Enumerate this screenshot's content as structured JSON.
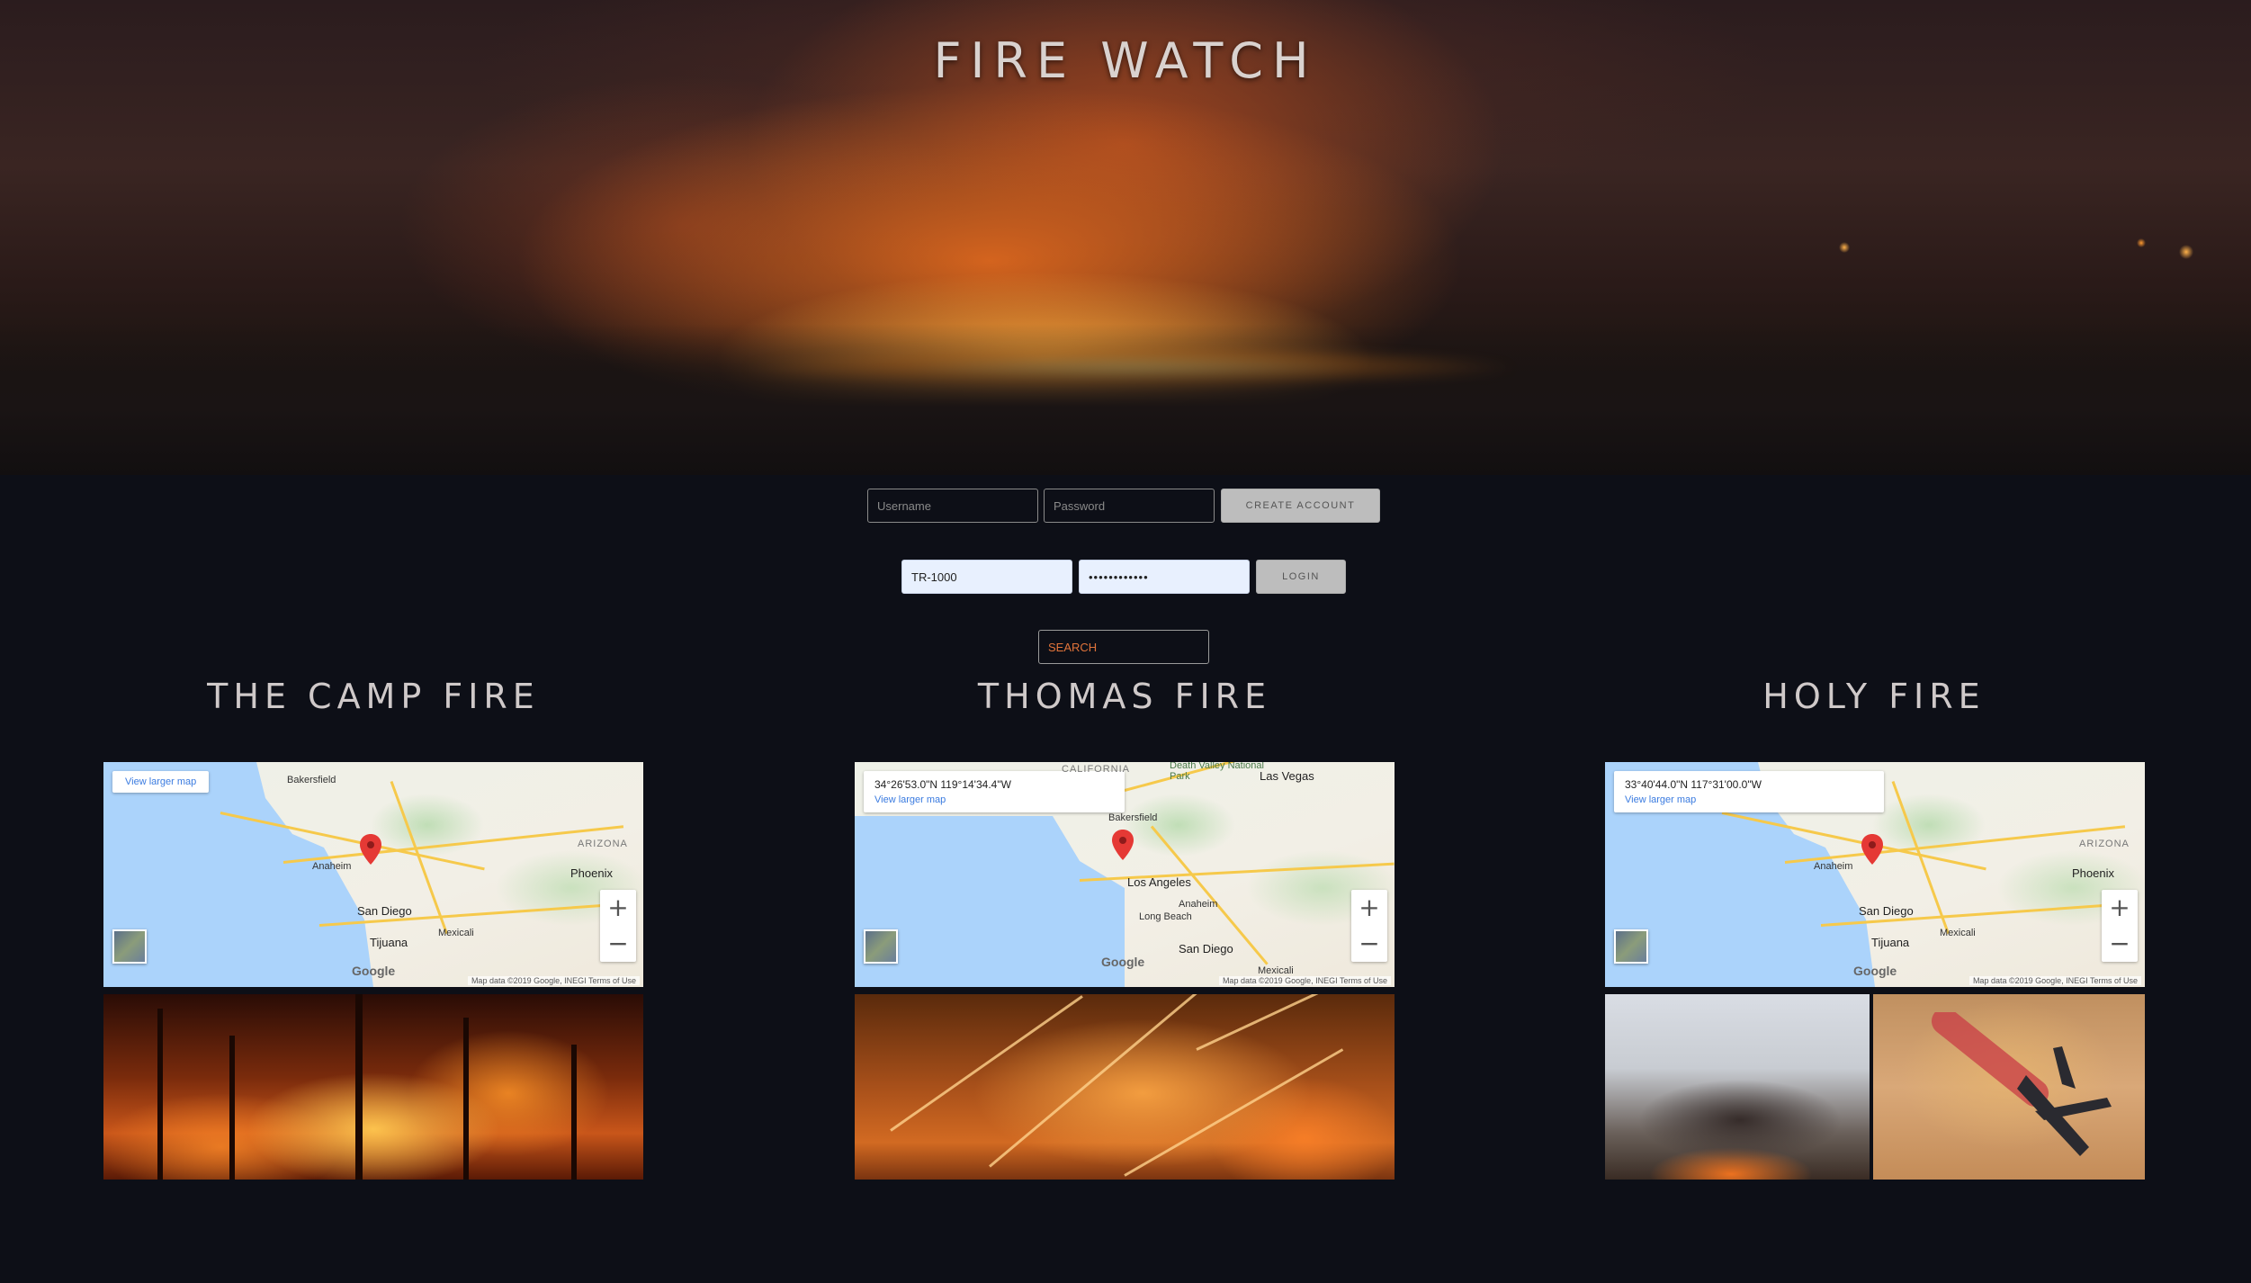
{
  "hero": {
    "title": "FIRE WATCH"
  },
  "create_account": {
    "username_placeholder": "Username",
    "password_placeholder": "Password",
    "button_label": "CREATE ACCOUNT"
  },
  "login": {
    "username_value": "TR-1000",
    "password_value": "••••••••••••",
    "button_label": "LOGIN"
  },
  "search": {
    "label": "SEARCH"
  },
  "fires": [
    {
      "name": "THE CAMP FIRE",
      "map": {
        "view_larger": "View larger map",
        "coords": "",
        "cities": [
          "Bakersfield",
          "Anaheim",
          "San Diego",
          "Tijuana",
          "Mexicali",
          "Phoenix",
          "ARIZONA"
        ],
        "attribution": "Map data ©2019 Google, INEGI   Terms of Use",
        "google": "Google"
      },
      "photo_icon": "forest-fire-photo"
    },
    {
      "name": "THOMAS FIRE",
      "map": {
        "view_larger": "View larger map",
        "coords": "34°26'53.0\"N 119°14'34.4\"W",
        "cities": [
          "Death Valley National Park",
          "Las Vegas",
          "Bakersfield",
          "Los Angeles",
          "Anaheim",
          "Long Beach",
          "San Diego",
          "Mexicali",
          "CALIFORNIA"
        ],
        "attribution": "Map data ©2019 Google, INEGI   Terms of Use",
        "google": "Google"
      },
      "photo_icon": "firefighter-embers-photo"
    },
    {
      "name": "HOLY FIRE",
      "map": {
        "view_larger": "View larger map",
        "coords": "33°40'44.0\"N 117°31'00.0\"W",
        "cities": [
          "Anaheim",
          "San Diego",
          "Tijuana",
          "Mexicali",
          "Phoenix",
          "ARIZONA"
        ],
        "attribution": "Map data ©2019 Google, INEGI   Terms of Use",
        "google": "Google"
      },
      "photo_icon": "smoke-and-air-tanker-photo"
    }
  ],
  "colors": {
    "background": "#0d0f17",
    "search_text": "#e0733a",
    "link": "#3a7be0",
    "pin": "#e53935"
  }
}
